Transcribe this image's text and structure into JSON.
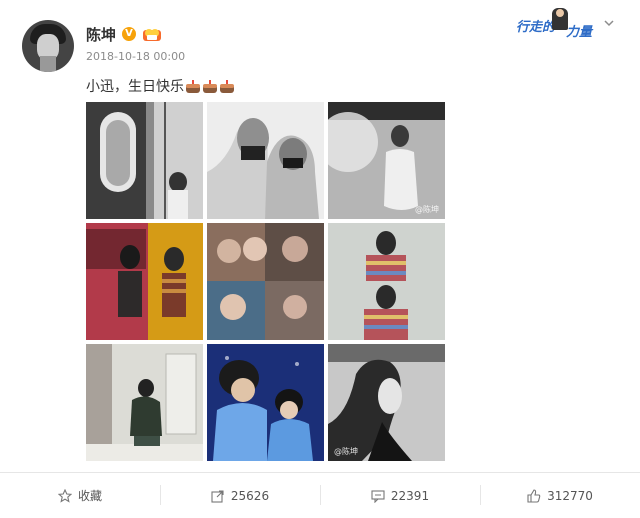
{
  "post": {
    "author": "陈坤",
    "timestamp": "2018-10-18 00:00",
    "text": "小迅，生日快乐",
    "emoji": [
      "cake-icon",
      "cake-icon",
      "cake-icon"
    ],
    "watermark": "@陈坤"
  },
  "header_promo": {
    "part1": "行走的",
    "part2": "力量"
  },
  "photos": [
    {
      "name": "photo-window-portrait"
    },
    {
      "name": "photo-hooded-figures"
    },
    {
      "name": "photo-white-dress"
    },
    {
      "name": "photo-duo-colored-sweaters"
    },
    {
      "name": "photo-collage-faces"
    },
    {
      "name": "photo-striped-sweater"
    },
    {
      "name": "photo-seated-scarf"
    },
    {
      "name": "photo-blue-hoodies"
    },
    {
      "name": "photo-bw-profile"
    }
  ],
  "actions": {
    "favorite": "收藏",
    "repost": "25626",
    "comment": "22391",
    "like": "312770"
  },
  "colors": {
    "accent_blue": "#2e6cc7",
    "vip_orange": "#f7a20a",
    "meta_gray": "#8c8c8c"
  }
}
